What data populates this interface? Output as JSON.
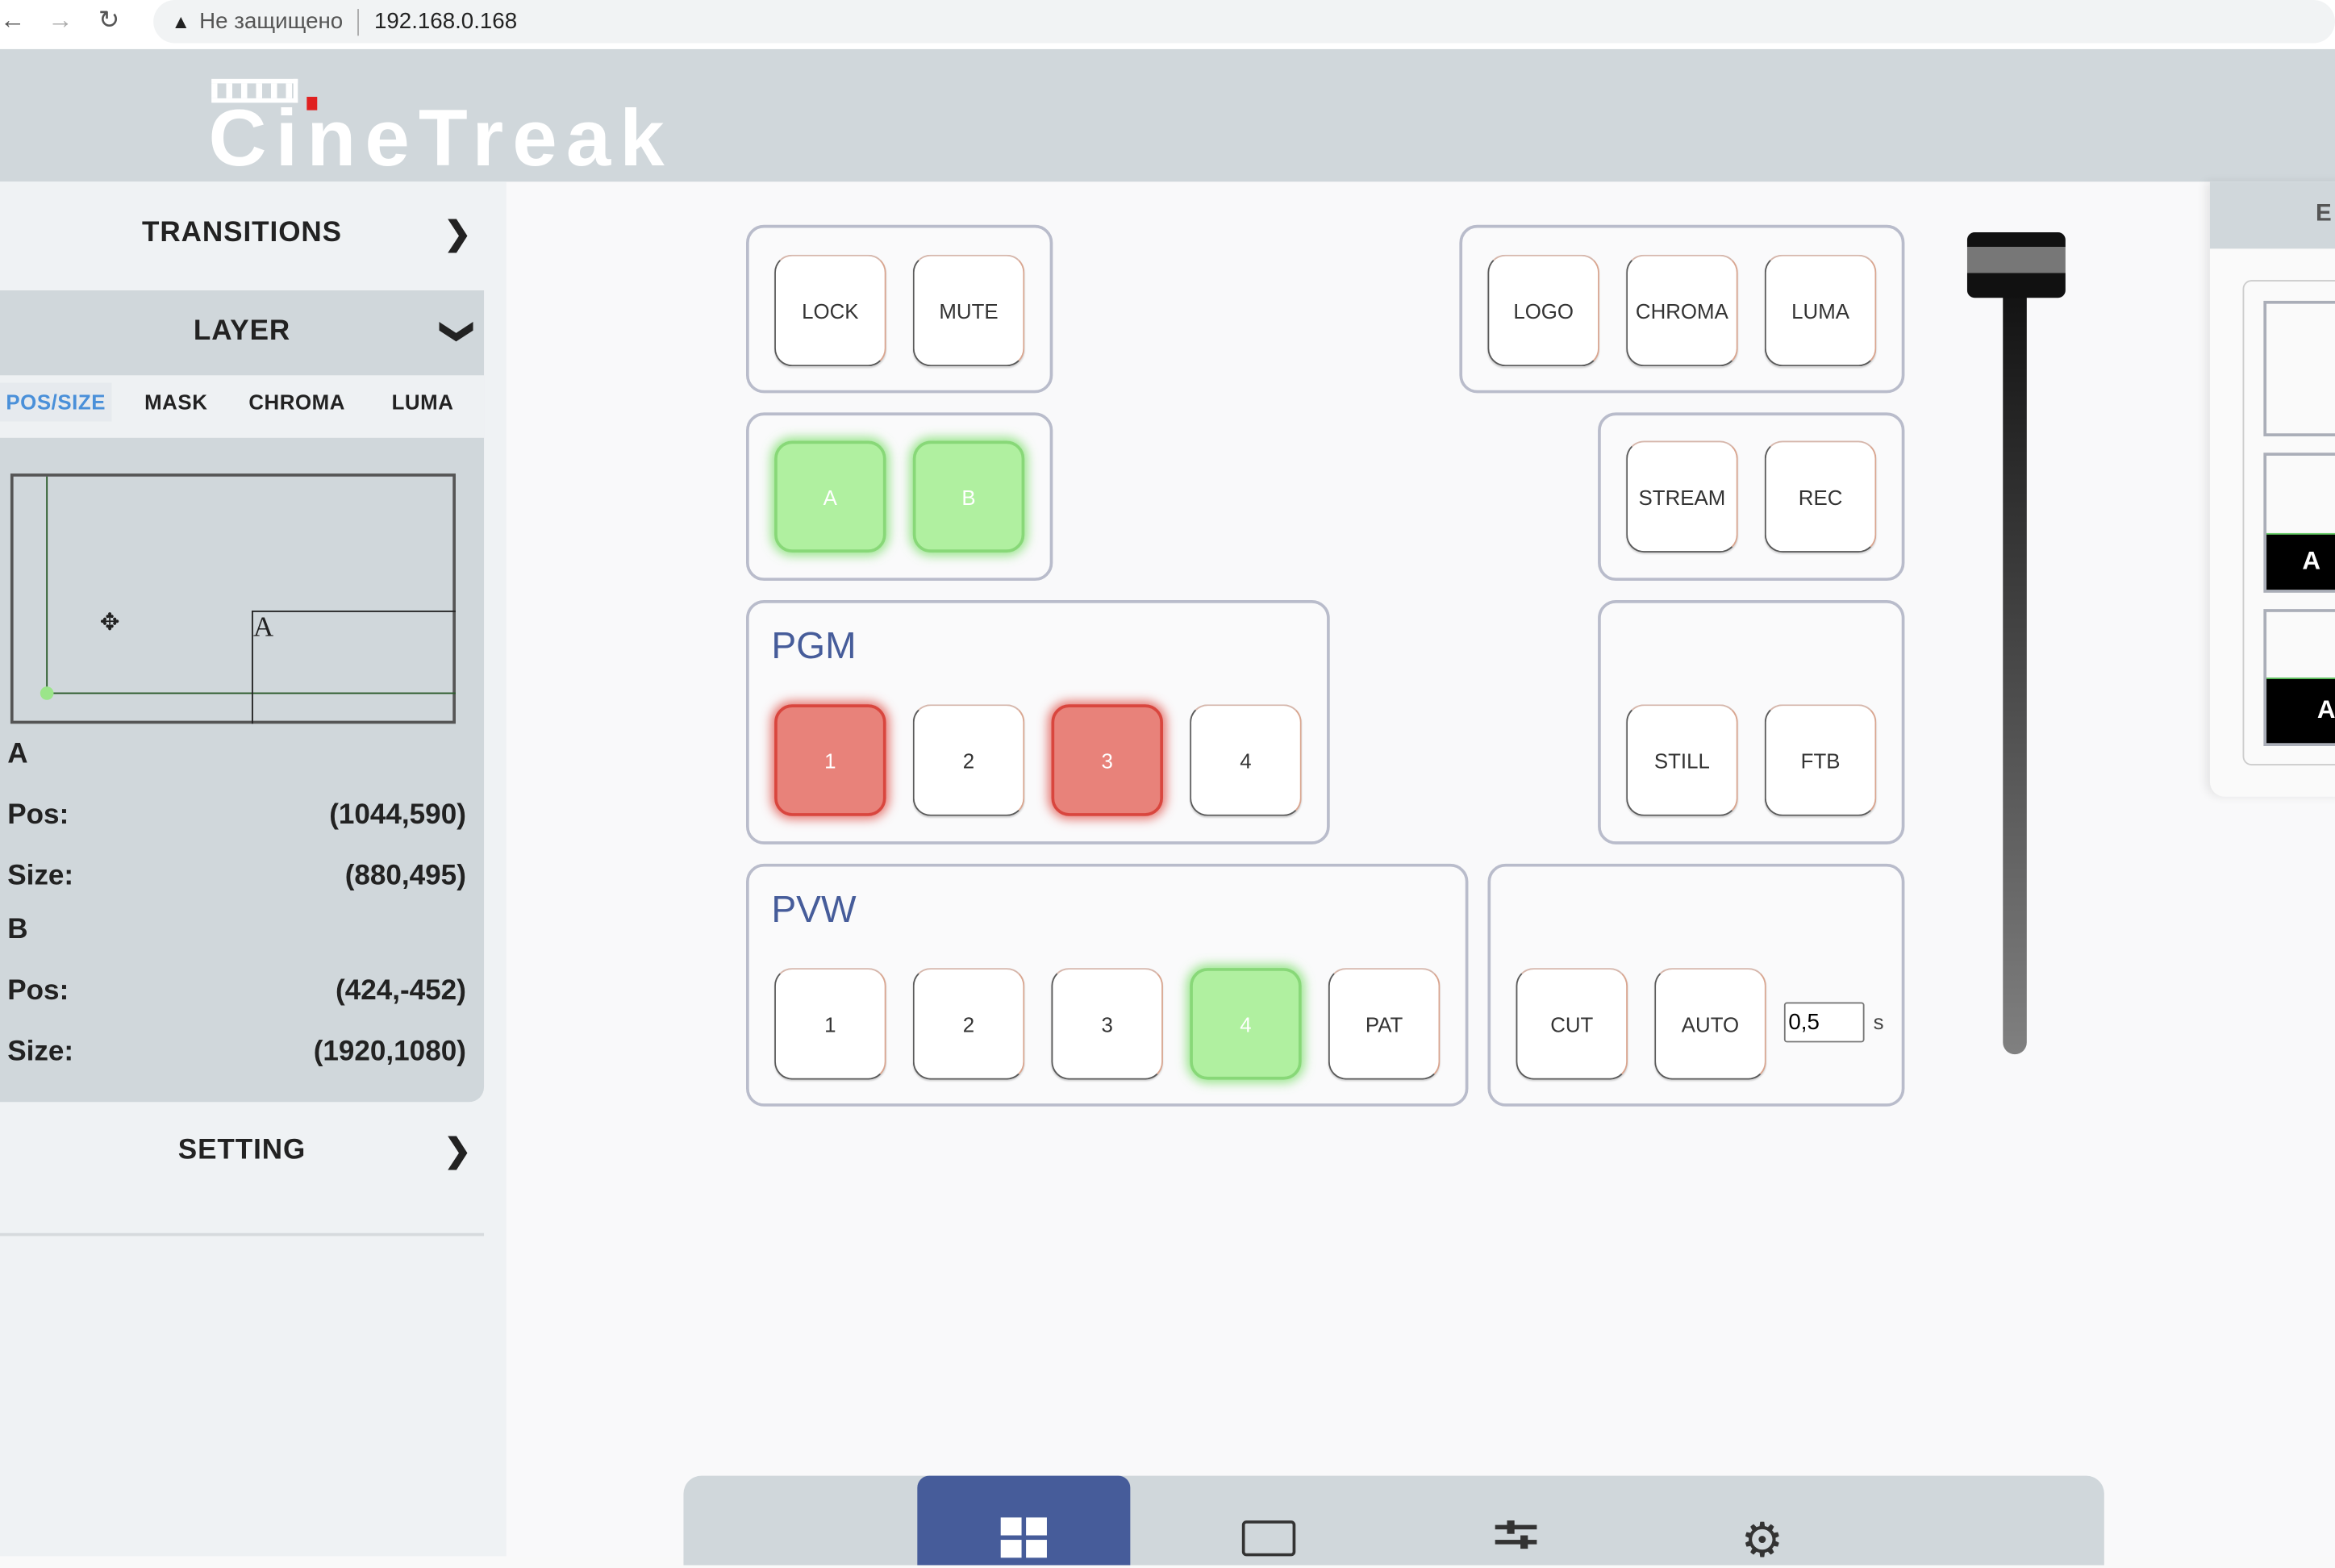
{
  "browser": {
    "security": "Не защищено",
    "url": "192.168.0.168"
  },
  "logo": {
    "text": "CineTreak",
    "accent": "#e02020"
  },
  "sidebar": {
    "transitions": "TRANSITIONS",
    "layer": "LAYER",
    "tabs": [
      {
        "label": "POS/SIZE",
        "active": true
      },
      {
        "label": "MASK"
      },
      {
        "label": "CHROMA"
      },
      {
        "label": "LUMA"
      }
    ],
    "preview_label": "A",
    "layers": [
      {
        "name": "A",
        "pos_label": "Pos:",
        "pos": "(1044,590)",
        "size_label": "Size:",
        "size": "(880,495)"
      },
      {
        "name": "B",
        "pos_label": "Pos:",
        "pos": "(424,-452)",
        "size_label": "Size:",
        "size": "(1920,1080)"
      }
    ],
    "setting": "SETTING"
  },
  "controls": {
    "lock": "LOCK",
    "mute": "MUTE",
    "logo": "LOGO",
    "chroma": "CHROMA",
    "luma": "LUMA",
    "a": "A",
    "b": "B",
    "stream": "STREAM",
    "rec": "REC",
    "pgm_title": "PGM",
    "pgm": [
      "1",
      "2",
      "3",
      "4"
    ],
    "pgm_active": [
      "1",
      "3"
    ],
    "still": "STILL",
    "ftb": "FTB",
    "pvw_title": "PVW",
    "pvw": [
      "1",
      "2",
      "3",
      "4",
      "PAT"
    ],
    "pvw_active": [
      "4"
    ],
    "cut": "CUT",
    "auto": "AUTO",
    "duration": "0,5",
    "duration_unit": "s"
  },
  "fader": {
    "position": 0
  },
  "right_panel": {
    "header": "E",
    "labels": [
      "A",
      "A"
    ]
  },
  "bottom_nav": [
    {
      "icon": "grid-icon",
      "active": true
    },
    {
      "icon": "monitor-icon"
    },
    {
      "icon": "sliders-icon"
    },
    {
      "icon": "gear-icon"
    }
  ],
  "colors": {
    "header_bg": "#d0d7db",
    "active_nav": "#465c9a",
    "pgm_active": "#e8827a",
    "pvw_active": "#b0f0a0",
    "tab_active": "#4a90d9"
  }
}
